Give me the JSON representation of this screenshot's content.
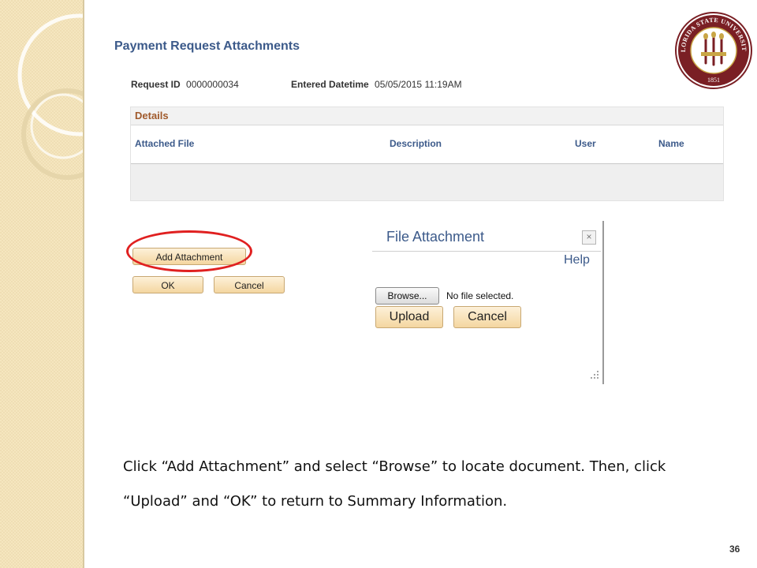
{
  "page": {
    "title": "Payment Request Attachments",
    "request_id_label": "Request ID",
    "request_id_value": "0000000034",
    "entered_datetime_label": "Entered Datetime",
    "entered_datetime_value": "05/05/2015 11:19AM"
  },
  "details": {
    "heading": "Details",
    "columns": [
      "Attached File",
      "Description",
      "User",
      "Name"
    ]
  },
  "actions": {
    "add_attachment": "Add Attachment",
    "ok": "OK",
    "cancel": "Cancel"
  },
  "dialog": {
    "title": "File Attachment",
    "close_glyph": "×",
    "help": "Help",
    "browse": "Browse...",
    "no_file": "No file selected.",
    "upload": "Upload",
    "cancel": "Cancel"
  },
  "seal": {
    "text_top": "FLORIDA STATE UNIVERSITY",
    "year": "1851"
  },
  "slide": {
    "instruction": "Click “Add Attachment” and select “Browse” to locate document. Then, click “Upload” and “OK” to return to Summary Information.",
    "page_number": "36"
  },
  "colors": {
    "accent": "#3c5a8a",
    "highlight": "#e02020",
    "seal": "#7a1f24"
  }
}
